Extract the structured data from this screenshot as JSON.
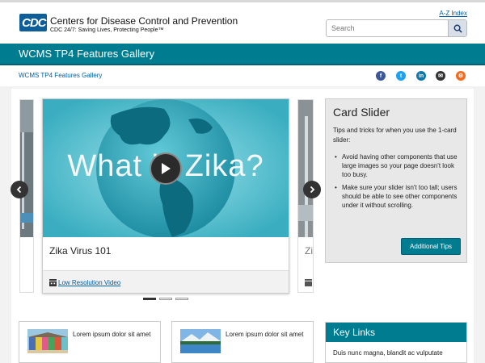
{
  "header": {
    "logo_text": "CDC",
    "org_name": "Centers for Disease Control and Prevention",
    "tagline": "CDC 24/7: Saving Lives, Protecting People™",
    "az_link": "A-Z Index",
    "search_placeholder": "Search"
  },
  "site": {
    "title": "WCMS TP4 Features Gallery",
    "breadcrumb": "WCMS TP4 Features Gallery"
  },
  "social": [
    {
      "name": "facebook",
      "glyph": "f",
      "color": "#3b5998"
    },
    {
      "name": "twitter",
      "glyph": "t",
      "color": "#1da1f2"
    },
    {
      "name": "linkedin",
      "glyph": "in",
      "color": "#0e76a8"
    },
    {
      "name": "email",
      "glyph": "✉",
      "color": "#333333"
    },
    {
      "name": "syndicate",
      "glyph": "⚙",
      "color": "#f26b21"
    }
  ],
  "carousel": {
    "video_overlay": "What is Zika?",
    "card_title": "Zika Virus 101",
    "footer_link": "Low Resolution Video",
    "peek_right_title": "Zi",
    "slide_count": 3,
    "active_slide": 1
  },
  "aside": {
    "title": "Card Slider",
    "intro": "Tips and tricks for when you use the 1-card slider:",
    "tips": [
      "Avoid having other components that use large images so your page doesn't look too busy.",
      "Make sure your slider isn't too tall; users should be able to see other components under it without scrolling."
    ],
    "button": "Additional Tips"
  },
  "mini_cards": [
    {
      "text": "Lorem ipsum dolor sit amet"
    },
    {
      "text": "Lorem ipsum dolor sit amet"
    }
  ],
  "key_links": {
    "title": "Key Links",
    "text": "Duis nunc magna, blandit ac vulputate"
  },
  "colors": {
    "primary_teal": "#007c91",
    "link_blue": "#005ea2",
    "cdc_blue": "#0e5e9a"
  }
}
